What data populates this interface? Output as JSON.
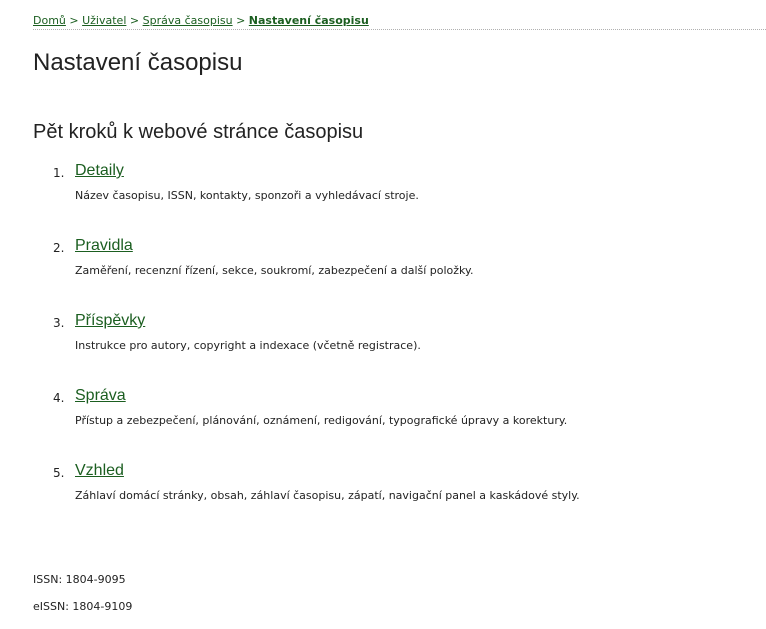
{
  "breadcrumb": {
    "home": "Domů",
    "user": "Uživatel",
    "journal_management": "Správa časopisu",
    "current": "Nastavení časopisu",
    "separator": ">"
  },
  "page_title": "Nastavení časopisu",
  "section_title": "Pět kroků k webové stránce časopisu",
  "steps": [
    {
      "number": "1.",
      "label": "Detaily",
      "description": "Název časopisu, ISSN, kontakty, sponzoři a vyhledávací stroje."
    },
    {
      "number": "2.",
      "label": "Pravidla",
      "description": "Zaměření, recenzní řízení, sekce, soukromí, zabezpečení a další položky."
    },
    {
      "number": "3.",
      "label": "Příspěvky",
      "description": "Instrukce pro autory, copyright a indexace (včetně registrace)."
    },
    {
      "number": "4.",
      "label": "Správa",
      "description": "Přístup a zebezpečení, plánování, oznámení, redigování, typografické úpravy a korektury."
    },
    {
      "number": "5.",
      "label": "Vzhled",
      "description": "Záhlaví domácí stránky, obsah, záhlaví časopisu, zápatí, navigační panel a kaskádové styly."
    }
  ],
  "footer": {
    "issn": "ISSN: 1804-9095",
    "eissn": "eISSN: 1804-9109"
  },
  "colors": {
    "link": "#1b5e20",
    "text": "#222222",
    "background": "#ffffff"
  }
}
